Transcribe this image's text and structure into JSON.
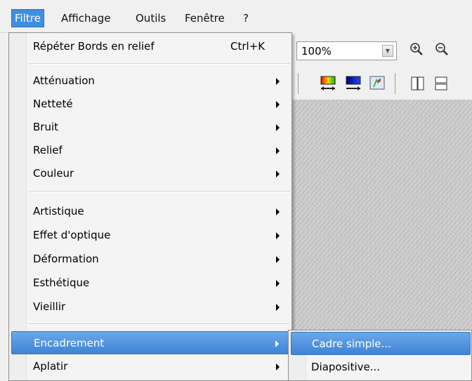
{
  "menubar": {
    "items": [
      {
        "label": "Filtre"
      },
      {
        "label": "Affichage"
      },
      {
        "label": "Outils"
      },
      {
        "label": "Fenêtre"
      },
      {
        "label": "?"
      }
    ]
  },
  "toolbar": {
    "zoom_value": "100%",
    "icons": [
      "zoom-in-icon",
      "zoom-out-icon",
      "color-adjust-icon",
      "monitor-icon",
      "image-effect-icon",
      "book-icon",
      "panel-icon"
    ]
  },
  "menu": {
    "repeat_item": {
      "label": "Répéter Bords en relief",
      "shortcut": "Ctrl+K"
    },
    "group1": [
      {
        "label": "Atténuation"
      },
      {
        "label": "Netteté"
      },
      {
        "label": "Bruit"
      },
      {
        "label": "Relief"
      },
      {
        "label": "Couleur"
      }
    ],
    "group2": [
      {
        "label": "Artistique"
      },
      {
        "label": "Effet d'optique"
      },
      {
        "label": "Déformation"
      },
      {
        "label": "Esthétique"
      },
      {
        "label": "Vieillir"
      }
    ],
    "group3": [
      {
        "label": "Encadrement"
      },
      {
        "label": "Aplatir"
      }
    ]
  },
  "submenu": {
    "items": [
      {
        "label": "Cadre simple..."
      },
      {
        "label": "Diapositive..."
      }
    ]
  },
  "colors": {
    "highlight": "#3f84d6",
    "menu_bg": "#f4f4f4"
  }
}
